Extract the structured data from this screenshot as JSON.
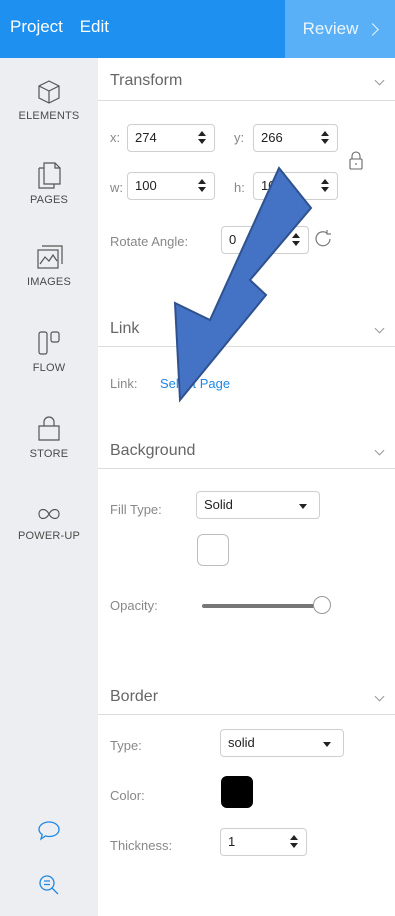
{
  "topbar": {
    "menu": [
      "Project",
      "Edit"
    ],
    "review_label": "Review"
  },
  "sidebar": {
    "items": [
      {
        "label": "ELEMENTS",
        "icon": "cube-icon"
      },
      {
        "label": "PAGES",
        "icon": "pages-icon"
      },
      {
        "label": "IMAGES",
        "icon": "images-icon"
      },
      {
        "label": "FLOW",
        "icon": "flow-icon"
      },
      {
        "label": "STORE",
        "icon": "store-bag-icon"
      },
      {
        "label": "POWER-UP",
        "icon": "infinity-icon"
      }
    ],
    "bottom_icons": [
      "chat-bubble-icon",
      "zoom-out-icon"
    ]
  },
  "transform": {
    "title": "Transform",
    "x_label": "x:",
    "x_value": "274",
    "y_label": "y:",
    "y_value": "266",
    "w_label": "w:",
    "w_value": "100",
    "h_label": "h:",
    "h_value": "100",
    "rotate_label": "Rotate Angle:",
    "rotate_value": "0"
  },
  "link": {
    "title": "Link",
    "label": "Link:",
    "value": "Select Page"
  },
  "background": {
    "title": "Background",
    "fill_type_label": "Fill Type:",
    "fill_type_value": "Solid",
    "fill_color": "#ffffff",
    "opacity_label": "Opacity:",
    "opacity_value": 1.0
  },
  "border": {
    "title": "Border",
    "type_label": "Type:",
    "type_value": "solid",
    "color_label": "Color:",
    "color_value": "#000000",
    "thickness_label": "Thickness:",
    "thickness_value": "1"
  },
  "colors": {
    "brand": "#1e90f0",
    "review_bg": "#5ab0f6",
    "arrow_fill": "#4472c4",
    "arrow_stroke": "#2f528f",
    "link": "#1e88e5"
  },
  "annotation": {
    "arrow": "big-blue-arrow-pointing-to-select-page"
  }
}
